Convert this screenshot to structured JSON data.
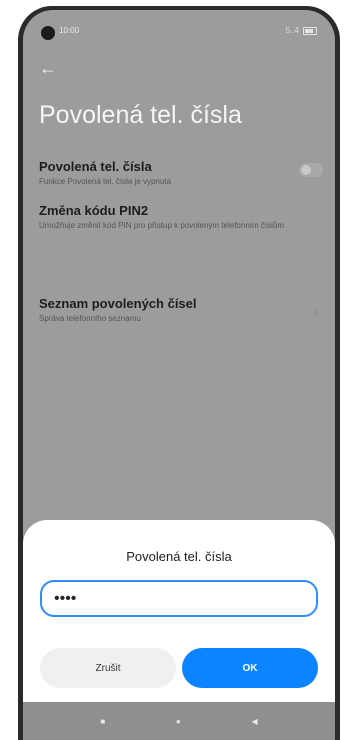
{
  "status": {
    "time": "10:00",
    "signal": "5..4"
  },
  "header": {
    "back_icon": "arrow-left-icon",
    "title": "Povolená tel. čísla"
  },
  "settings": [
    {
      "title": "Povolená tel. čísla",
      "subtitle": "Funkce Povolená tel. čísla je vypnuta",
      "control": "toggle-off"
    },
    {
      "title": "Změna kódu PIN2",
      "subtitle": "Umožňuje změnit kód PIN pro přístup k povoleným telefonním číslům",
      "control": ""
    },
    {
      "title": "Seznam povolených čísel",
      "subtitle": "Správa telefonního seznamu",
      "control": "chevron-right-icon"
    }
  ],
  "dialog": {
    "title": "Povolená tel. čísla",
    "input_value": "••••",
    "cancel_label": "Zrušit",
    "ok_label": "OK"
  },
  "navbar": {
    "square": "■",
    "circle": "●",
    "back": "◀"
  },
  "colors": {
    "accent": "#0d84ff",
    "overlay": "#9c9c9c",
    "dialog": "#ffffff"
  }
}
